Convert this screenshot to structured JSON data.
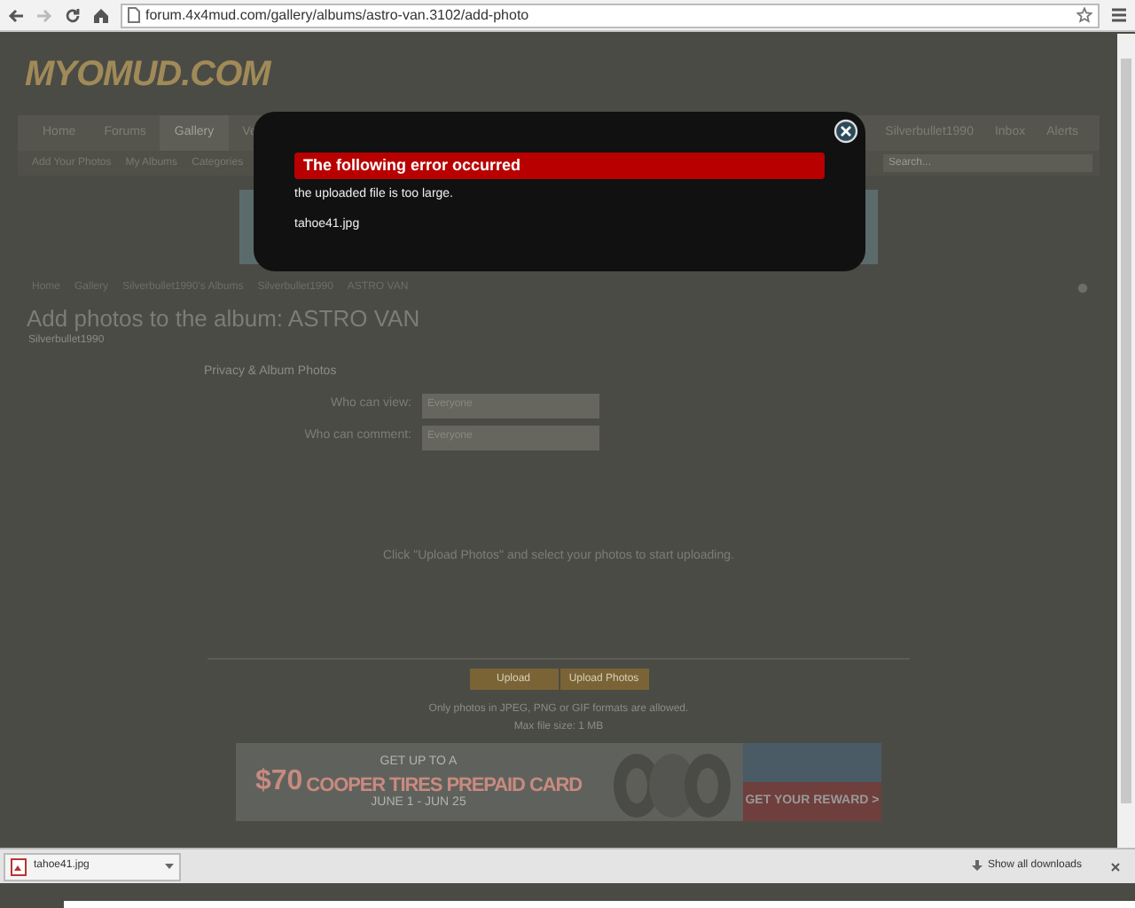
{
  "browser": {
    "url": "forum.4x4mud.com/gallery/albums/astro-van.3102/add-photo"
  },
  "site": {
    "logo": "MYOMUD.COM",
    "nav": [
      {
        "label": "Home",
        "selected": false
      },
      {
        "label": "Forums",
        "selected": false
      },
      {
        "label": "Gallery",
        "selected": true
      },
      {
        "label": "Ve",
        "selected": false
      }
    ],
    "user_nav": [
      "Silverbullet1990",
      "Inbox",
      "Alerts"
    ],
    "sub_nav": [
      "Add Your Photos",
      "My Albums",
      "Categories"
    ],
    "search": {
      "placeholder": "Search..."
    },
    "breadcrumbs": [
      "Home",
      "Gallery",
      "Silverbullet1990's Albums",
      "Silverbullet1990",
      "ASTRO VAN"
    ],
    "heading": "Add photos to the album: ASTRO VAN",
    "subheading": "Silverbullet1990",
    "section_title": "Privacy & Album Photos",
    "fields": [
      {
        "label": "Who can view:",
        "value": "Everyone"
      },
      {
        "label": "Who can comment:",
        "value": "Everyone"
      }
    ],
    "hint": "Click \"Upload Photos\" and select your photos to start uploading.",
    "buttons": [
      "Upload",
      "Upload Photos"
    ],
    "footer": [
      "Only photos in JPEG, PNG or GIF formats are allowed.",
      "Max file size: 1 MB"
    ],
    "ad": {
      "top": "GET UP TO A",
      "amount": "$70",
      "headline": "COOPER TIRES PREPAID CARD",
      "dates": "JUNE 1 - JUN 25",
      "cta": "GET YOUR REWARD >"
    }
  },
  "dialog": {
    "title": "The following error occurred",
    "message": "the uploaded file is too large.",
    "file": "tahoe41.jpg"
  },
  "downloads": {
    "file": "tahoe41.jpg",
    "show_all": "Show all downloads"
  }
}
